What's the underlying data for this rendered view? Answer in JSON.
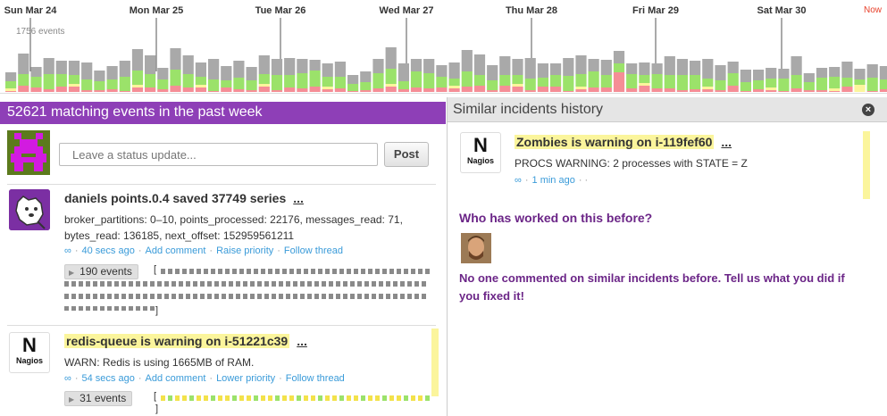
{
  "timeline": {
    "days": [
      "Sun Mar 24",
      "Mon Mar 25",
      "Tue Mar 26",
      "Wed Mar 27",
      "Thu Mar 28",
      "Fri Mar 29",
      "Sat Mar 30"
    ],
    "now_label": "Now",
    "events_count": "1756 events",
    "colors": {
      "gray": "#a9a9a9",
      "green": "#9be26a",
      "pink": "#f58e96",
      "yellow": "#fbf59c",
      "tick": "#555555"
    }
  },
  "left": {
    "header": "52621 matching events in the past week",
    "status_placeholder": "Leave a status update...",
    "post_label": "Post",
    "events": [
      {
        "icon": "datadog-dog-icon",
        "title": "daniels points.0.4 saved 37749 series",
        "more": "...",
        "body": "broker_partitions: 0–10, points_processed: 22176, messages_read: 71, bytes_read: 136185, next_offset: 152959561211",
        "infinity": "∞",
        "time": "40 secs ago",
        "actions": [
          "Add comment",
          "Raise priority",
          "Follow thread"
        ],
        "events_count": "190 events",
        "bracket_open": "[",
        "bracket_close": "]"
      },
      {
        "icon": "nagios-icon",
        "title": "redis-queue is warning on i-51221c39",
        "more": "...",
        "body": "WARN: Redis is using 1665MB of RAM.",
        "infinity": "∞",
        "time": "54 secs ago",
        "actions": [
          "Add comment",
          "Lower priority",
          "Follow thread"
        ],
        "events_count": "31 events",
        "bracket_open": "[",
        "bracket_close": "]"
      }
    ]
  },
  "right": {
    "header": "Similar incidents history",
    "close_label": "×",
    "incident": {
      "title": "Zombies is warning on i-119fef60",
      "more": "...",
      "body": "PROCS WARNING: 2 processes with STATE = Z",
      "infinity": "∞",
      "time": "1 min ago",
      "trail": "· ·"
    },
    "who_title": "Who has worked on this before?",
    "no_comment": "No one commented on similar incidents before. Tell us what you did if you fixed it!"
  },
  "nagios": {
    "letter": "N",
    "word": "Nagios"
  }
}
